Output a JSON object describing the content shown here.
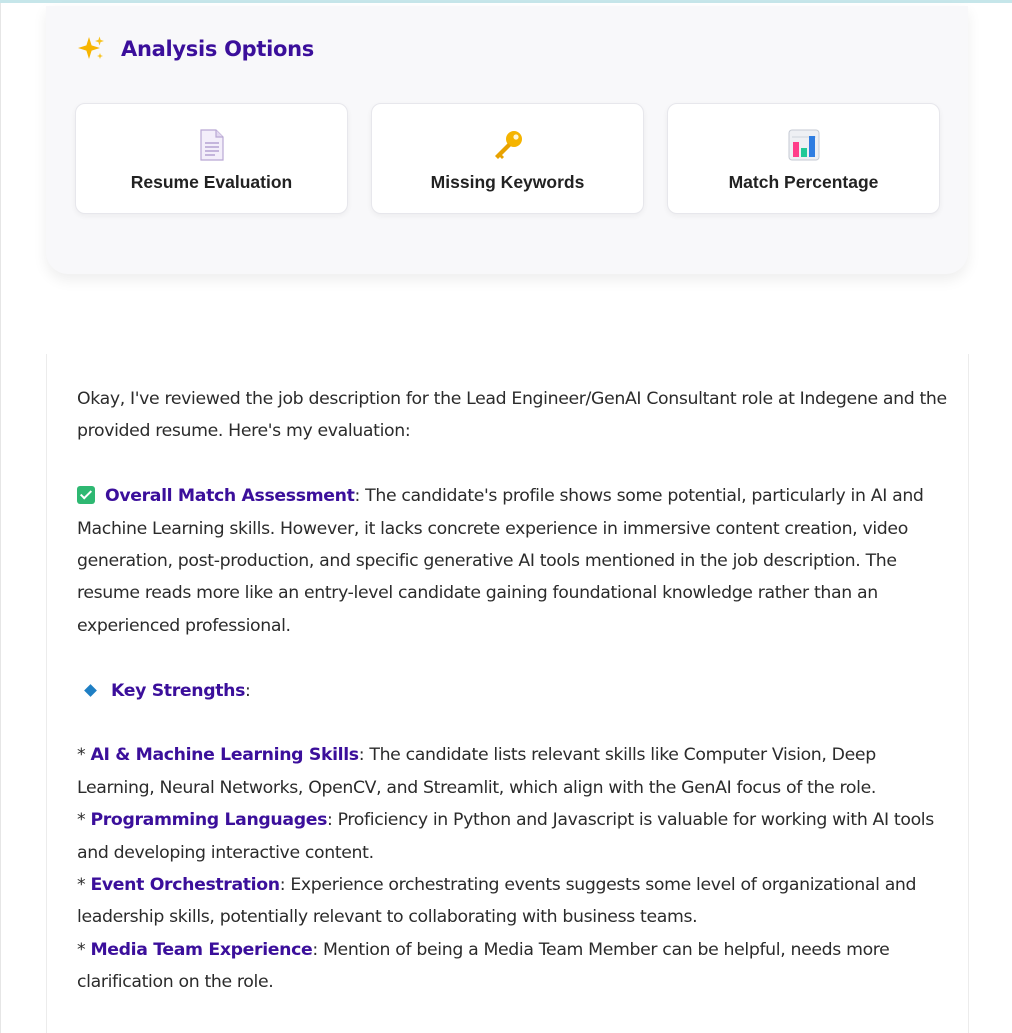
{
  "options": {
    "title": "Analysis Options",
    "header_icon": "sparkles-icon",
    "buttons": [
      {
        "label": "Resume Evaluation",
        "icon": "document-icon"
      },
      {
        "label": "Missing Keywords",
        "icon": "key-icon"
      },
      {
        "label": "Match Percentage",
        "icon": "bar-chart-icon"
      }
    ]
  },
  "result": {
    "intro": "Okay, I've reviewed the job description for the Lead Engineer/GenAI Consultant role at Indegene and the provided resume. Here's my evaluation:",
    "overall": {
      "heading": "Overall Match Assessment",
      "text": ": The candidate's profile shows some potential, particularly in AI and Machine Learning skills. However, it lacks concrete experience in immersive content creation, video generation, post-production, and specific generative AI tools mentioned in the job description. The resume reads more like an entry-level candidate gaining foundational knowledge rather than an experienced professional."
    },
    "strengths_heading": "Key Strengths",
    "strengths_suffix": ":",
    "bullet_marker": "* ",
    "strengths": [
      {
        "title": "AI & Machine Learning Skills",
        "text": ": The candidate lists relevant skills like Computer Vision, Deep Learning, Neural Networks, OpenCV, and Streamlit, which align with the GenAI focus of the role."
      },
      {
        "title": "Programming Languages",
        "text": ": Proficiency in Python and Javascript is valuable for working with AI tools and developing interactive content."
      },
      {
        "title": "Event Orchestration",
        "text": ": Experience orchestrating events suggests some level of organizational and leadership skills, potentially relevant to collaborating with business teams."
      },
      {
        "title": "Media Team Experience",
        "text": ": Mention of being a Media Team Member can be helpful, needs more clarification on the role."
      }
    ],
    "colors": {
      "accent": "#3b0f9b",
      "check": "#2eb872",
      "diamond": "#1f7fc4"
    }
  }
}
